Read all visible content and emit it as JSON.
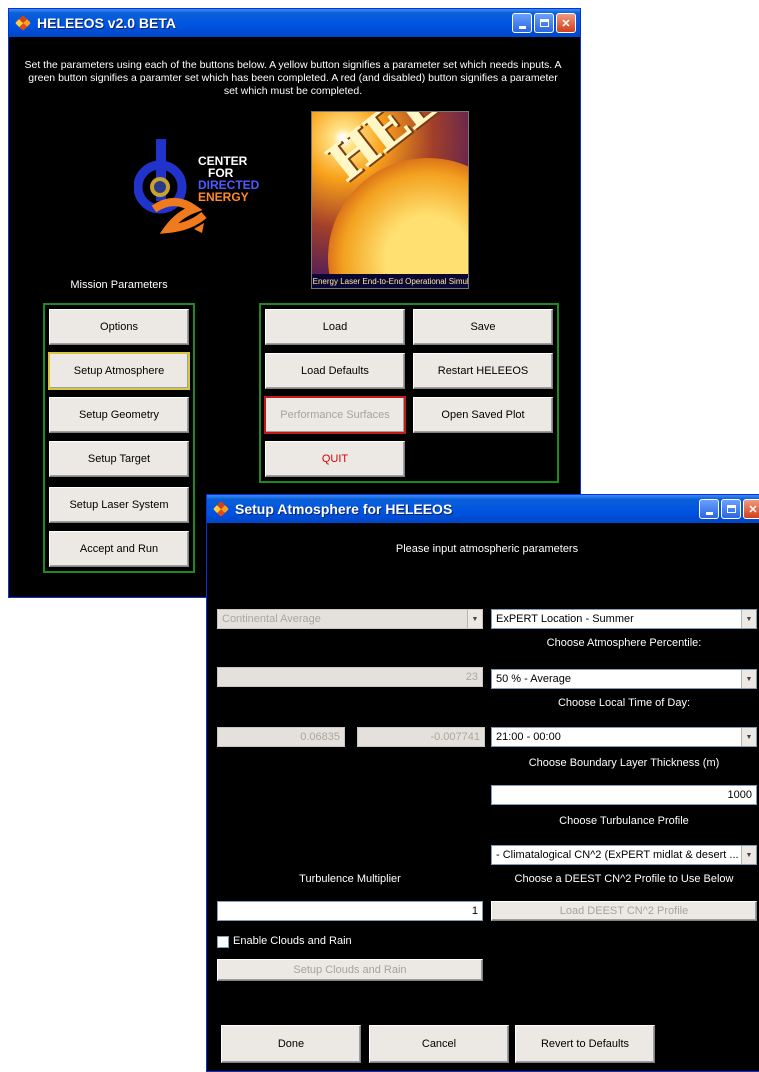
{
  "main_window": {
    "title": "HELEEOS v2.0 BETA",
    "instructions": "Set the parameters using each of the buttons below.  A yellow button signifies a parameter set which needs inputs.  A green button signifies a paramter set which has been completed.  A red (and disabled) button signifies a parameter set which must be completed.",
    "logo": {
      "line1": "CENTER",
      "line2": "FOR",
      "line3": "DIRECTED",
      "line4": "ENERGY"
    },
    "banner": {
      "word": "HELEEOS",
      "caption": "High Energy Laser End-to-End Operational Simulation"
    },
    "mission_parameters_label": "Mission Parameters",
    "mission_buttons": [
      "Options",
      "Setup Atmosphere",
      "Setup Geometry",
      "Setup Target",
      "Setup Laser System",
      "Accept and Run"
    ],
    "file_buttons": {
      "load": "Load",
      "save": "Save",
      "load_defaults": "Load Defaults",
      "restart": "Restart HELEEOS",
      "performance_surfaces": "Performance Surfaces",
      "open_saved_plot": "Open Saved Plot",
      "quit": "QUIT"
    },
    "colors": {
      "green_group": "#1c8a1c",
      "yellow_highlight": "#d8c63c",
      "red_highlight": "#c21a1a",
      "quit_text": "#d30000"
    }
  },
  "atmo_window": {
    "title": "Setup Atmosphere for HELEEOS",
    "prompt": "Please input atmospheric parameters",
    "left_dropdown": "Continental Average",
    "location_dropdown": "ExPERT Location - Summer",
    "percentile_label": "Choose Atmosphere Percentile:",
    "left_value_1": "23",
    "percentile_dropdown": "50 % - Average",
    "time_label": "Choose Local Time of Day:",
    "left_value_2": "0.06835",
    "left_value_3": "-0.007741",
    "time_dropdown": "21:00 - 00:00",
    "boundary_label": "Choose Boundary Layer Thickness (m)",
    "boundary_value": "1000",
    "turbulence_profile_label": "Choose Turbulance Profile",
    "turbulence_profile_dropdown": "- Climatalogical CN^2 (ExPERT midlat & desert ...",
    "turbulence_multiplier_label": "Turbulence Multiplier",
    "deest_label": "Choose a DEEST CN^2 Profile to Use Below",
    "turbulence_multiplier_value": "1",
    "load_deest_button": "Load DEEST CN^2 Profile",
    "clouds_checkbox_label": "Enable Clouds and Rain",
    "clouds_checked": false,
    "setup_clouds_button": "Setup Clouds and Rain",
    "done_button": "Done",
    "cancel_button": "Cancel",
    "revert_button": "Revert to Defaults"
  }
}
